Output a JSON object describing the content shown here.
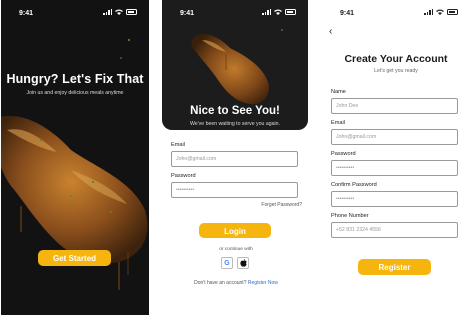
{
  "status_bar": {
    "time": "9:41"
  },
  "screen1": {
    "title": "Hungry? Let's Fix That",
    "subtitle": "Join us and enjoy delicious meals anytime",
    "cta_label": "Get Started"
  },
  "screen2": {
    "title": "Nice to See You!",
    "subtitle": "We've been waiting to serve you again.",
    "email_label": "Email",
    "email_placeholder": "John@gmail.com",
    "password_label": "Password",
    "password_placeholder": "••••••••••",
    "forgot_label": "Forget Password?",
    "login_label": "Login",
    "or_label": "or continue with",
    "google_icon_glyph": "G",
    "no_account_text": "Don't have an account?",
    "register_link": "Register Now"
  },
  "screen3": {
    "back_glyph": "‹",
    "title": "Create Your Account",
    "subtitle": "Let's get you ready",
    "fields": [
      {
        "label": "Name",
        "placeholder": "John Dee"
      },
      {
        "label": "Email",
        "placeholder": "John@gmail.com"
      },
      {
        "label": "Password",
        "placeholder": "••••••••••"
      },
      {
        "label": "Confirm Password",
        "placeholder": "••••••••••"
      },
      {
        "label": "Phone Number",
        "placeholder": "+52 831 2324 4556"
      }
    ],
    "register_label": "Register"
  },
  "colors": {
    "accent": "#f6b40e",
    "dark_bg": "#121212",
    "link": "#2f6fd1"
  },
  "icons": [
    "signal-icon",
    "wifi-icon",
    "battery-icon",
    "back-icon",
    "google-icon",
    "apple-icon",
    "food-image"
  ]
}
